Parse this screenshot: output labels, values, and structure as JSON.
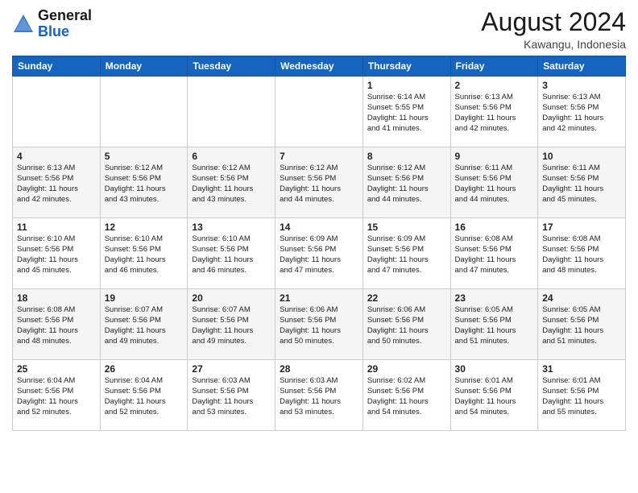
{
  "header": {
    "logo_general": "General",
    "logo_blue": "Blue",
    "month_year": "August 2024",
    "location": "Kawangu, Indonesia"
  },
  "days_of_week": [
    "Sunday",
    "Monday",
    "Tuesday",
    "Wednesday",
    "Thursday",
    "Friday",
    "Saturday"
  ],
  "weeks": [
    [
      {
        "day": "",
        "info": ""
      },
      {
        "day": "",
        "info": ""
      },
      {
        "day": "",
        "info": ""
      },
      {
        "day": "",
        "info": ""
      },
      {
        "day": "1",
        "info": "Sunrise: 6:14 AM\nSunset: 5:55 PM\nDaylight: 11 hours\nand 41 minutes."
      },
      {
        "day": "2",
        "info": "Sunrise: 6:13 AM\nSunset: 5:56 PM\nDaylight: 11 hours\nand 42 minutes."
      },
      {
        "day": "3",
        "info": "Sunrise: 6:13 AM\nSunset: 5:56 PM\nDaylight: 11 hours\nand 42 minutes."
      }
    ],
    [
      {
        "day": "4",
        "info": "Sunrise: 6:13 AM\nSunset: 5:56 PM\nDaylight: 11 hours\nand 42 minutes."
      },
      {
        "day": "5",
        "info": "Sunrise: 6:12 AM\nSunset: 5:56 PM\nDaylight: 11 hours\nand 43 minutes."
      },
      {
        "day": "6",
        "info": "Sunrise: 6:12 AM\nSunset: 5:56 PM\nDaylight: 11 hours\nand 43 minutes."
      },
      {
        "day": "7",
        "info": "Sunrise: 6:12 AM\nSunset: 5:56 PM\nDaylight: 11 hours\nand 44 minutes."
      },
      {
        "day": "8",
        "info": "Sunrise: 6:12 AM\nSunset: 5:56 PM\nDaylight: 11 hours\nand 44 minutes."
      },
      {
        "day": "9",
        "info": "Sunrise: 6:11 AM\nSunset: 5:56 PM\nDaylight: 11 hours\nand 44 minutes."
      },
      {
        "day": "10",
        "info": "Sunrise: 6:11 AM\nSunset: 5:56 PM\nDaylight: 11 hours\nand 45 minutes."
      }
    ],
    [
      {
        "day": "11",
        "info": "Sunrise: 6:10 AM\nSunset: 5:56 PM\nDaylight: 11 hours\nand 45 minutes."
      },
      {
        "day": "12",
        "info": "Sunrise: 6:10 AM\nSunset: 5:56 PM\nDaylight: 11 hours\nand 46 minutes."
      },
      {
        "day": "13",
        "info": "Sunrise: 6:10 AM\nSunset: 5:56 PM\nDaylight: 11 hours\nand 46 minutes."
      },
      {
        "day": "14",
        "info": "Sunrise: 6:09 AM\nSunset: 5:56 PM\nDaylight: 11 hours\nand 47 minutes."
      },
      {
        "day": "15",
        "info": "Sunrise: 6:09 AM\nSunset: 5:56 PM\nDaylight: 11 hours\nand 47 minutes."
      },
      {
        "day": "16",
        "info": "Sunrise: 6:08 AM\nSunset: 5:56 PM\nDaylight: 11 hours\nand 47 minutes."
      },
      {
        "day": "17",
        "info": "Sunrise: 6:08 AM\nSunset: 5:56 PM\nDaylight: 11 hours\nand 48 minutes."
      }
    ],
    [
      {
        "day": "18",
        "info": "Sunrise: 6:08 AM\nSunset: 5:56 PM\nDaylight: 11 hours\nand 48 minutes."
      },
      {
        "day": "19",
        "info": "Sunrise: 6:07 AM\nSunset: 5:56 PM\nDaylight: 11 hours\nand 49 minutes."
      },
      {
        "day": "20",
        "info": "Sunrise: 6:07 AM\nSunset: 5:56 PM\nDaylight: 11 hours\nand 49 minutes."
      },
      {
        "day": "21",
        "info": "Sunrise: 6:06 AM\nSunset: 5:56 PM\nDaylight: 11 hours\nand 50 minutes."
      },
      {
        "day": "22",
        "info": "Sunrise: 6:06 AM\nSunset: 5:56 PM\nDaylight: 11 hours\nand 50 minutes."
      },
      {
        "day": "23",
        "info": "Sunrise: 6:05 AM\nSunset: 5:56 PM\nDaylight: 11 hours\nand 51 minutes."
      },
      {
        "day": "24",
        "info": "Sunrise: 6:05 AM\nSunset: 5:56 PM\nDaylight: 11 hours\nand 51 minutes."
      }
    ],
    [
      {
        "day": "25",
        "info": "Sunrise: 6:04 AM\nSunset: 5:56 PM\nDaylight: 11 hours\nand 52 minutes."
      },
      {
        "day": "26",
        "info": "Sunrise: 6:04 AM\nSunset: 5:56 PM\nDaylight: 11 hours\nand 52 minutes."
      },
      {
        "day": "27",
        "info": "Sunrise: 6:03 AM\nSunset: 5:56 PM\nDaylight: 11 hours\nand 53 minutes."
      },
      {
        "day": "28",
        "info": "Sunrise: 6:03 AM\nSunset: 5:56 PM\nDaylight: 11 hours\nand 53 minutes."
      },
      {
        "day": "29",
        "info": "Sunrise: 6:02 AM\nSunset: 5:56 PM\nDaylight: 11 hours\nand 54 minutes."
      },
      {
        "day": "30",
        "info": "Sunrise: 6:01 AM\nSunset: 5:56 PM\nDaylight: 11 hours\nand 54 minutes."
      },
      {
        "day": "31",
        "info": "Sunrise: 6:01 AM\nSunset: 5:56 PM\nDaylight: 11 hours\nand 55 minutes."
      }
    ]
  ]
}
